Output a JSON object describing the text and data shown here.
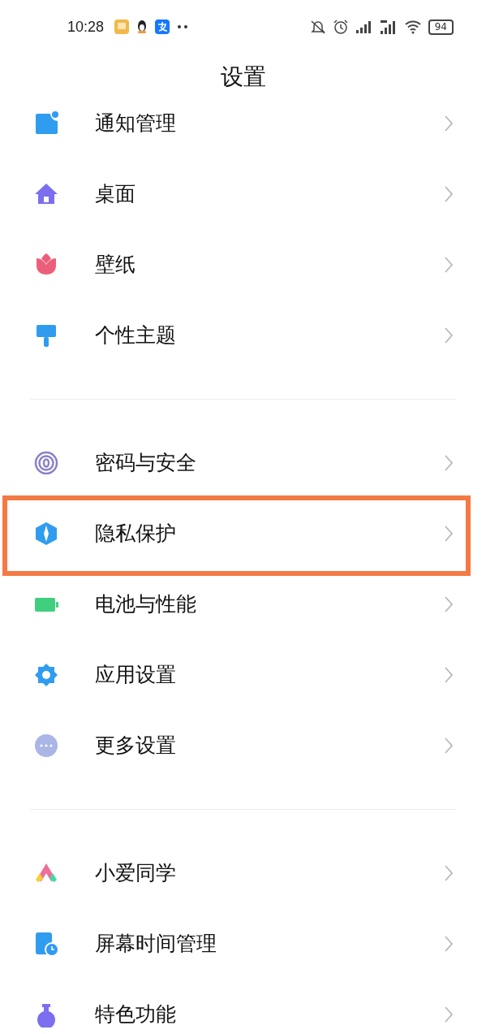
{
  "status_bar": {
    "time": "10:28",
    "battery": "94"
  },
  "title": "设置",
  "groups": [
    [
      {
        "label": "通知管理",
        "highlighted": false
      },
      {
        "label": "桌面",
        "highlighted": false
      },
      {
        "label": "壁纸",
        "highlighted": false
      },
      {
        "label": "个性主题",
        "highlighted": false
      }
    ],
    [
      {
        "label": "密码与安全",
        "highlighted": false
      },
      {
        "label": "隐私保护",
        "highlighted": true
      },
      {
        "label": "电池与性能",
        "highlighted": false
      },
      {
        "label": "应用设置",
        "highlighted": false
      },
      {
        "label": "更多设置",
        "highlighted": false
      }
    ],
    [
      {
        "label": "小爱同学",
        "highlighted": false
      },
      {
        "label": "屏幕时间管理",
        "highlighted": false
      },
      {
        "label": "特色功能",
        "highlighted": false
      }
    ]
  ]
}
